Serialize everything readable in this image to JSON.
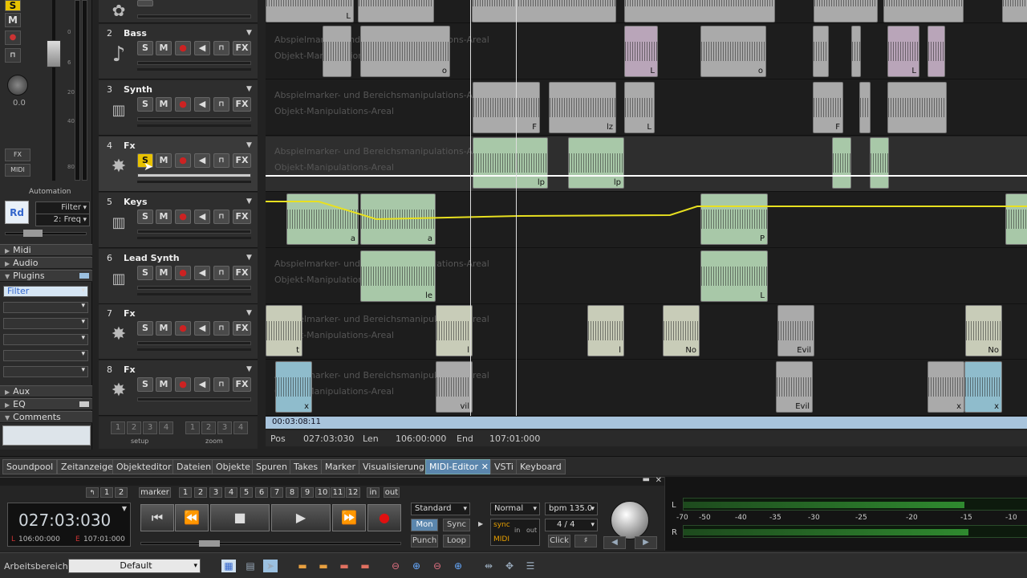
{
  "mixer": {
    "solo": "S",
    "mute": "M",
    "pan_value": "0.0",
    "fx_label": "FX",
    "midi_label": "MIDI",
    "automation_label": "Automation",
    "rd_label": "Rd",
    "automation_param": "Filter",
    "automation_sub": "2: Freq",
    "meter_ticks": [
      "0",
      "6",
      "20",
      "40",
      "80"
    ],
    "sections": [
      {
        "label": "Midi",
        "open": false
      },
      {
        "label": "Audio",
        "open": false
      },
      {
        "label": "Plugins",
        "open": true
      },
      {
        "label": "Aux",
        "open": false
      },
      {
        "label": "EQ",
        "open": false
      },
      {
        "label": "Comments",
        "open": true
      }
    ],
    "plugin_slot": "Filter"
  },
  "track_buttons": [
    "S",
    "M",
    "FX"
  ],
  "tracks": [
    {
      "num": "2",
      "name": "Bass",
      "icon": "guitar-icon"
    },
    {
      "num": "3",
      "name": "Synth",
      "icon": "keyboard-icon"
    },
    {
      "num": "4",
      "name": "Fx",
      "icon": "fx-icon"
    },
    {
      "num": "5",
      "name": "Keys",
      "icon": "keyboard-icon"
    },
    {
      "num": "6",
      "name": "Lead Synth",
      "icon": "keyboard-icon"
    },
    {
      "num": "7",
      "name": "Fx",
      "icon": "fx-icon"
    },
    {
      "num": "8",
      "name": "Fx",
      "icon": "fx-icon"
    }
  ],
  "lane_text": {
    "line1": "Abspielmarker- und Bereichsmanipulations-Areal",
    "line2": "Objekt-Manipulations-Areal"
  },
  "clip_labels": [
    "L",
    "o",
    "o",
    "L",
    "o",
    "L",
    "L",
    "F",
    "lz",
    "L",
    "F",
    "lp",
    "lp",
    "lp",
    "a",
    "a",
    "a",
    "a",
    "P",
    "le",
    "le",
    "L",
    "t",
    "l",
    "l",
    "No",
    "Evil",
    "No",
    "x",
    "vil",
    "Evil",
    "x",
    "x"
  ],
  "setup": {
    "nums": [
      "1",
      "2",
      "3",
      "4"
    ],
    "setup_label": "setup",
    "zoom_label": "zoom"
  },
  "position_bar": "00:03:08:11",
  "info": {
    "pos_label": "Pos",
    "pos_value": "027:03:030",
    "len_label": "Len",
    "len_value": "106:00:000",
    "end_label": "End",
    "end_value": "107:01:000"
  },
  "tabs": [
    "Soundpool",
    "Zeitanzeige",
    "Objekteditor",
    "Dateien",
    "Objekte",
    "Spuren",
    "Takes",
    "Marker",
    "Visualisierung",
    "MIDI-Editor",
    "VSTi",
    "Keyboard"
  ],
  "active_tab": "MIDI-Editor",
  "transport": {
    "counter": "027:03:030",
    "l_label": "L",
    "l_value": "106:00:000",
    "e_label": "E",
    "e_value": "107:01:000",
    "marker_label": "marker",
    "marker_nums": [
      "1",
      "2",
      "3",
      "4",
      "5",
      "6",
      "7",
      "8",
      "9",
      "10",
      "11",
      "12"
    ],
    "loop_nums": [
      "1",
      "2"
    ],
    "in_label": "in",
    "out_label": "out",
    "mode": "Standard",
    "mon": "Mon",
    "sync": "Sync",
    "punch": "Punch",
    "loop": "Loop",
    "sync_small": "sync",
    "midi_small": "MIDI",
    "in_small": "in",
    "out_small": "out",
    "normal": "Normal",
    "bpm": "bpm 135.0",
    "signature": "4 / 4",
    "click": "Click"
  },
  "meter": {
    "l": "L",
    "r": "R",
    "scale": [
      "-70",
      "-50",
      "-40",
      "-35",
      "-30",
      "-25",
      "-20",
      "-15",
      "-10"
    ]
  },
  "bottom": {
    "workspace_label": "Arbeitsbereich:",
    "workspace_value": "Default"
  }
}
